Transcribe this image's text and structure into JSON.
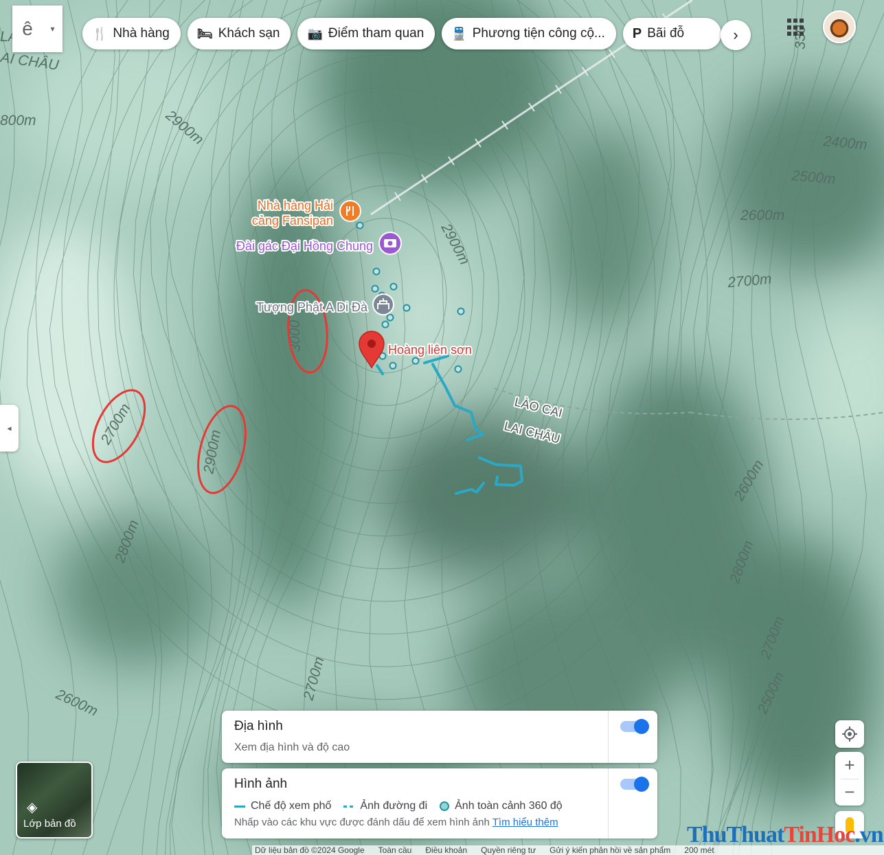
{
  "search": {
    "logo_glyph": "ê",
    "dropdown_glyph": "▾"
  },
  "chips": [
    {
      "icon": "restaurant-icon",
      "glyph": "🍴",
      "label": "Nhà hàng"
    },
    {
      "icon": "hotel-icon",
      "glyph": "🛏",
      "label": "Khách sạn"
    },
    {
      "icon": "camera-icon",
      "glyph": "📷",
      "label": "Điểm tham quan"
    },
    {
      "icon": "transit-icon",
      "glyph": "🚆",
      "label": "Phương tiện công cộ..."
    },
    {
      "icon": "parking-icon",
      "glyph": "P",
      "label": "Bãi đỗ"
    }
  ],
  "chip_more_glyph": "›",
  "side_tab_glyph": "◂",
  "map": {
    "contour_labels": [
      {
        "text": "2900m"
      },
      {
        "text": "2400m"
      },
      {
        "text": "2500m"
      },
      {
        "text": "2600m"
      },
      {
        "text": "2700m"
      },
      {
        "text": "2900m"
      },
      {
        "text": "3000"
      },
      {
        "text": "2700m"
      },
      {
        "text": "2900m"
      },
      {
        "text": "2800m"
      },
      {
        "text": "2700m"
      },
      {
        "text": "2600m"
      },
      {
        "text": "2800m"
      },
      {
        "text": "2700m"
      },
      {
        "text": "2600m"
      },
      {
        "text": "2500m"
      },
      {
        "text": "800m"
      },
      {
        "text": "LA"
      },
      {
        "text": "AI CHÂU"
      },
      {
        "text": "330"
      }
    ],
    "region_labels": [
      "LÀO CAI",
      "LAI CHÂU"
    ],
    "places": [
      {
        "name_line1": "Nhà hàng Hải",
        "name_line2": "cảng Fansipan",
        "icon": "restaurant-pin-icon",
        "color": "#f07d26"
      },
      {
        "name": "Đài gác Đại Hồng Chung",
        "icon": "camera-pin-icon",
        "color": "#9b59d0"
      },
      {
        "name": "Tượng Phật A Di Đà",
        "icon": "temple-pin-icon",
        "color": "#7b8794"
      },
      {
        "name": "Hoàng liên sơn",
        "icon": "red-pin-icon",
        "color": "#e53935"
      }
    ],
    "colors": {
      "contour": "#5e7f72",
      "route": "#2aa8c4",
      "highlight": "#e53935",
      "cable": "#e8eef0"
    }
  },
  "layers_button": {
    "label": "Lớp bản đồ",
    "icon": "layers-icon"
  },
  "panel_terrain": {
    "title": "Địa hình",
    "subtitle": "Xem địa hình và độ cao",
    "toggle_on": true
  },
  "panel_imagery": {
    "title": "Hình ảnh",
    "legend": [
      "Chế độ xem phố",
      "Ảnh đường đi",
      "Ảnh toàn cảnh 360 độ"
    ],
    "hint": "Nhấp vào các khu vực được đánh dấu để xem hình ảnh",
    "link": "Tìm hiểu thêm",
    "toggle_on": true
  },
  "controls": {
    "zoom_in": "+",
    "zoom_out": "−"
  },
  "footer": [
    "Dữ liệu bản đồ ©2024 Google",
    "Toàn cầu",
    "Điều khoản",
    "Quyền riêng tư",
    "Gửi ý kiến phản hồi về sản phẩm",
    "200 mét"
  ],
  "watermark": {
    "part1": "ThuThuat",
    "part2": "TinHoc",
    "part3": ".vn"
  }
}
